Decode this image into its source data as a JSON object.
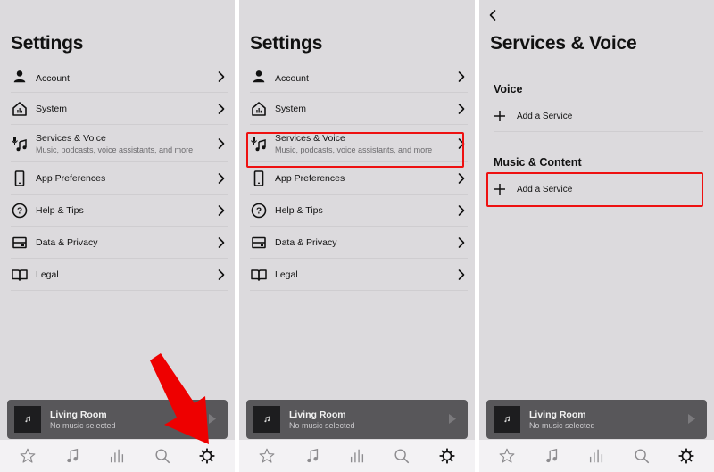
{
  "screens": [
    {
      "title": "Settings",
      "items": [
        {
          "icon": "person-icon",
          "label": "Account",
          "sublabel": ""
        },
        {
          "icon": "house-icon",
          "label": "System",
          "sublabel": ""
        },
        {
          "icon": "mic-music-icon",
          "label": "Services & Voice",
          "sublabel": "Music, podcasts, voice assistants, and more"
        },
        {
          "icon": "phone-icon",
          "label": "App Preferences",
          "sublabel": ""
        },
        {
          "icon": "help-circle-icon",
          "label": "Help & Tips",
          "sublabel": ""
        },
        {
          "icon": "data-box-icon",
          "label": "Data & Privacy",
          "sublabel": ""
        },
        {
          "icon": "book-icon",
          "label": "Legal",
          "sublabel": ""
        }
      ],
      "highlight": "selected-tab-settings-arrow"
    },
    {
      "title": "Settings",
      "items": [
        {
          "icon": "person-icon",
          "label": "Account",
          "sublabel": ""
        },
        {
          "icon": "house-icon",
          "label": "System",
          "sublabel": ""
        },
        {
          "icon": "mic-music-icon",
          "label": "Services & Voice",
          "sublabel": "Music, podcasts, voice assistants, and more"
        },
        {
          "icon": "phone-icon",
          "label": "App Preferences",
          "sublabel": ""
        },
        {
          "icon": "help-circle-icon",
          "label": "Help & Tips",
          "sublabel": ""
        },
        {
          "icon": "data-box-icon",
          "label": "Data & Privacy",
          "sublabel": ""
        },
        {
          "icon": "book-icon",
          "label": "Legal",
          "sublabel": ""
        }
      ],
      "highlight": "Services & Voice"
    },
    {
      "title": "Services & Voice",
      "back_icon": "chevron-left-icon",
      "sections": [
        {
          "heading": "Voice",
          "action": "Add a Service"
        },
        {
          "heading": "Music & Content",
          "action": "Add a Service"
        }
      ],
      "highlight": "Music & Content / Add a Service"
    }
  ],
  "now_playing": {
    "room": "Living Room",
    "status": "No music selected",
    "art_icon": "music-note-icon",
    "play_icon": "play-icon"
  },
  "tabbar": [
    {
      "name": "favorites",
      "icon": "star-icon"
    },
    {
      "name": "browse",
      "icon": "music-note-icon"
    },
    {
      "name": "rooms",
      "icon": "bars-icon"
    },
    {
      "name": "search",
      "icon": "search-icon"
    },
    {
      "name": "settings",
      "icon": "gear-icon",
      "active": true
    }
  ],
  "colors": {
    "panel_bg": "#dcdadd",
    "highlight_red": "#ee1111",
    "now_playing_bg": "#58575a",
    "tabbar_bg": "#f3f2f4"
  }
}
